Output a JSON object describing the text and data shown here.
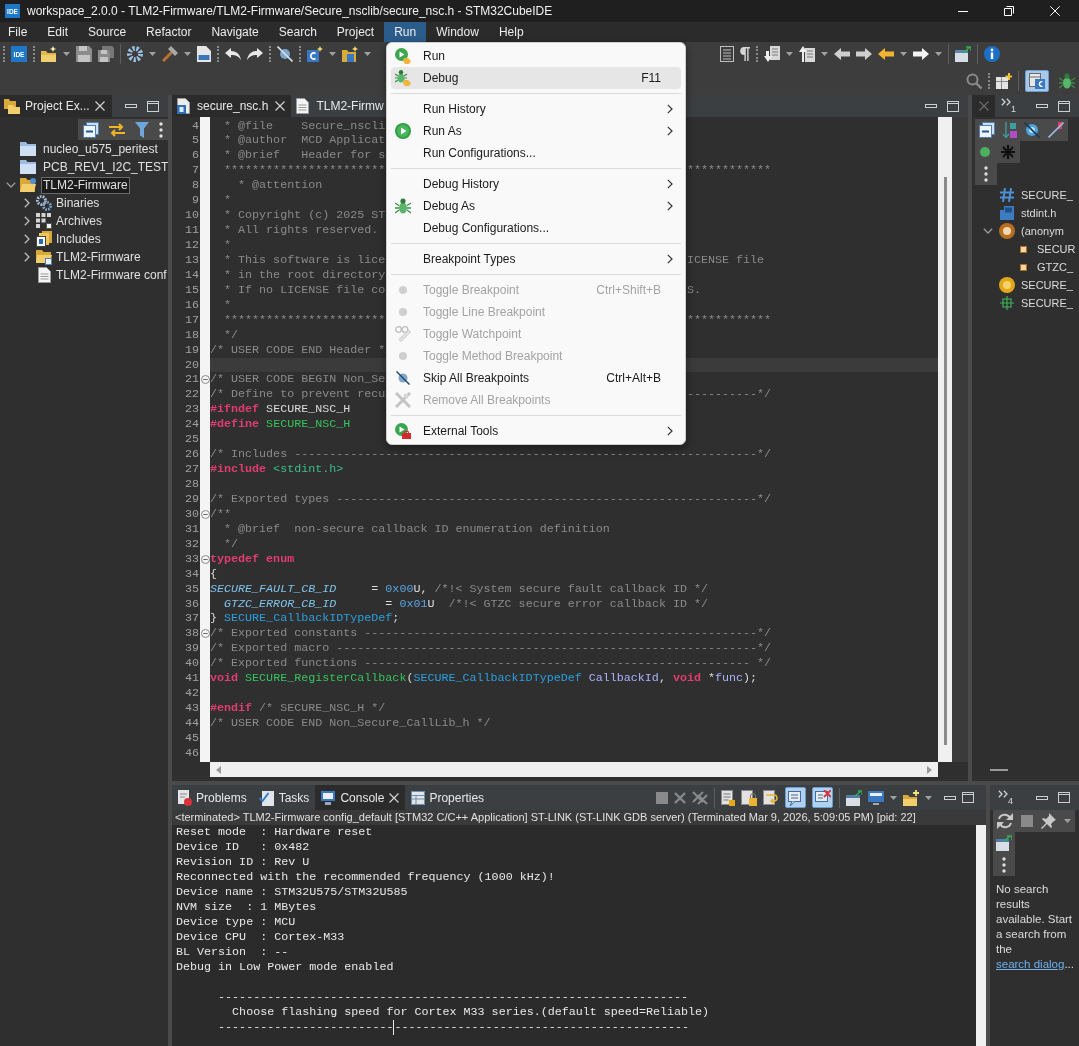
{
  "window": {
    "icon_text": "IDE",
    "title": "workspace_2.0.0 - TLM2-Firmware/TLM2-Firmware/Secure_nsclib/secure_nsc.h - STM32CubeIDE"
  },
  "menu_bar": [
    {
      "label": "File",
      "selected": false
    },
    {
      "label": "Edit",
      "selected": false
    },
    {
      "label": "Source",
      "selected": false
    },
    {
      "label": "Refactor",
      "selected": false
    },
    {
      "label": "Navigate",
      "selected": false
    },
    {
      "label": "Search",
      "selected": false
    },
    {
      "label": "Project",
      "selected": false
    },
    {
      "label": "Run",
      "selected": true
    },
    {
      "label": "Window",
      "selected": false
    },
    {
      "label": "Help",
      "selected": false
    }
  ],
  "toolbar": {
    "ide_text": "IDE",
    "perspectives": [
      {
        "selected": true
      },
      {
        "selected": false
      }
    ]
  },
  "project_explorer": {
    "tab": {
      "label": "Project Ex...",
      "selected": true
    },
    "items": [
      {
        "label": "nucleo_u575_peritest",
        "kind": "closed",
        "selected": false
      },
      {
        "label": "PCB_REV1_I2C_TEST",
        "kind": "closed",
        "selected": false
      },
      {
        "label": "TLM2-Firmware",
        "kind": "project",
        "selected": true,
        "expanded": true,
        "children": [
          {
            "label": "Binaries",
            "kind": "binaries",
            "selected": false,
            "expanded": false
          },
          {
            "label": "Archives",
            "kind": "archives",
            "selected": false,
            "expanded": false
          },
          {
            "label": "Includes",
            "kind": "includes",
            "selected": false,
            "expanded": false
          },
          {
            "label": "TLM2-Firmware",
            "kind": "folder",
            "selected": false,
            "expanded": false
          },
          {
            "label": "TLM2-Firmware conf",
            "kind": "file",
            "selected": false
          }
        ]
      }
    ]
  },
  "editor": {
    "tabs": [
      {
        "label": "secure_nsc.h",
        "selected": true
      },
      {
        "label": "TLM2-Firmw",
        "selected": false
      }
    ],
    "lines": [
      {
        "num": "4",
        "current": false,
        "foldable": false,
        "tokens": [
          {
            "kind": "comment",
            "text": "  * @file    Secure_nscli"
          }
        ]
      },
      {
        "num": "5",
        "current": false,
        "foldable": false,
        "tokens": [
          {
            "kind": "comment",
            "text": "  * @author  MCD Applicat"
          }
        ]
      },
      {
        "num": "6",
        "current": false,
        "foldable": false,
        "tokens": [
          {
            "kind": "comment",
            "text": "  * @brief   Header for s"
          }
        ]
      },
      {
        "num": "7",
        "current": false,
        "foldable": false,
        "tokens": [
          {
            "kind": "comment",
            "text": "  ***********************"
          }
        ],
        "tail": [
          {
            "kind": "comment",
            "text": "************"
          }
        ]
      },
      {
        "num": "8",
        "current": false,
        "foldable": false,
        "tokens": [
          {
            "kind": "comment",
            "text": "    * @attention"
          }
        ]
      },
      {
        "num": "9",
        "current": false,
        "foldable": false,
        "tokens": [
          {
            "kind": "comment",
            "text": "  *"
          }
        ]
      },
      {
        "num": "10",
        "current": false,
        "foldable": false,
        "tokens": [
          {
            "kind": "comment",
            "text": "  * Copyright (c) 2025 ST"
          }
        ]
      },
      {
        "num": "11",
        "current": false,
        "foldable": false,
        "tokens": [
          {
            "kind": "comment",
            "text": "  * All rights reserved."
          }
        ]
      },
      {
        "num": "12",
        "current": false,
        "foldable": false,
        "tokens": [
          {
            "kind": "comment",
            "text": "  *"
          }
        ]
      },
      {
        "num": "13",
        "current": false,
        "foldable": false,
        "tokens": [
          {
            "kind": "comment",
            "text": "  * This software is lice"
          }
        ],
        "tail": [
          {
            "kind": "comment",
            "text": "ICENSE file"
          }
        ]
      },
      {
        "num": "14",
        "current": false,
        "foldable": false,
        "tokens": [
          {
            "kind": "comment",
            "text": "  * in the root directory"
          }
        ]
      },
      {
        "num": "15",
        "current": false,
        "foldable": false,
        "tokens": [
          {
            "kind": "comment",
            "text": "  * If no LICENSE file co"
          }
        ],
        "tail": [
          {
            "kind": "comment",
            "text": "S."
          }
        ]
      },
      {
        "num": "16",
        "current": false,
        "foldable": false,
        "tokens": [
          {
            "kind": "comment",
            "text": "  *"
          }
        ]
      },
      {
        "num": "17",
        "current": false,
        "foldable": false,
        "tokens": [
          {
            "kind": "comment",
            "text": "  ***********************"
          }
        ],
        "tail": [
          {
            "kind": "comment",
            "text": "************"
          }
        ]
      },
      {
        "num": "18",
        "current": false,
        "foldable": false,
        "tokens": [
          {
            "kind": "comment",
            "text": "  */"
          }
        ]
      },
      {
        "num": "19",
        "current": false,
        "foldable": false,
        "tokens": [
          {
            "kind": "comment",
            "text": "/* USER CODE END Header *"
          }
        ]
      },
      {
        "num": "20",
        "current": true,
        "foldable": false
      },
      {
        "num": "21",
        "current": false,
        "foldable": true,
        "tokens": [
          {
            "kind": "comment",
            "text": "/* USER CODE BEGIN Non_Se"
          }
        ]
      },
      {
        "num": "22",
        "current": false,
        "foldable": false,
        "tokens": [
          {
            "kind": "comment",
            "text": "/* Define to prevent recu"
          }
        ],
        "tail": [
          {
            "kind": "comment",
            "text": "----------*/"
          }
        ]
      },
      {
        "num": "23",
        "current": false,
        "foldable": false,
        "tokens": [
          {
            "kind": "directive",
            "text": "#ifndef"
          },
          {
            "kind": "plain",
            "text": " SECURE_NSC_H"
          }
        ]
      },
      {
        "num": "24",
        "current": false,
        "foldable": false,
        "tokens": [
          {
            "kind": "directive",
            "text": "#define"
          },
          {
            "kind": "macro",
            "text": " SECURE_NSC_H"
          }
        ]
      },
      {
        "num": "25",
        "current": false,
        "foldable": false
      },
      {
        "num": "26",
        "current": false,
        "foldable": false,
        "tokens": [
          {
            "kind": "comment",
            "text": "/* Includes ------------------------------------------------------------------*/"
          }
        ]
      },
      {
        "num": "27",
        "current": false,
        "foldable": false,
        "tokens": [
          {
            "kind": "directive",
            "text": "#include"
          },
          {
            "kind": "header",
            "text": " <stdint.h>"
          }
        ]
      },
      {
        "num": "28",
        "current": false,
        "foldable": false
      },
      {
        "num": "29",
        "current": false,
        "foldable": false,
        "tokens": [
          {
            "kind": "comment",
            "text": "/* Exported types ------------------------------------------------------------*/"
          }
        ]
      },
      {
        "num": "30",
        "current": false,
        "foldable": true,
        "tokens": [
          {
            "kind": "comment",
            "text": "/**"
          }
        ]
      },
      {
        "num": "31",
        "current": false,
        "foldable": false,
        "tokens": [
          {
            "kind": "comment",
            "text": "  * @brief  non-secure callback ID enumeration definition"
          }
        ]
      },
      {
        "num": "32",
        "current": false,
        "foldable": false,
        "tokens": [
          {
            "kind": "comment",
            "text": "  */"
          }
        ]
      },
      {
        "num": "33",
        "current": false,
        "foldable": true,
        "tokens": [
          {
            "kind": "keyword",
            "text": "typedef enum"
          }
        ]
      },
      {
        "num": "34",
        "current": false,
        "foldable": false,
        "tokens": [
          {
            "kind": "plain",
            "text": "{"
          }
        ]
      },
      {
        "num": "35",
        "current": false,
        "foldable": false,
        "tokens": [
          {
            "kind": "enumerator",
            "text": "SECURE_FAULT_CB_ID"
          },
          {
            "kind": "plain",
            "text": "     = "
          },
          {
            "kind": "number",
            "text": "0x00"
          },
          {
            "kind": "plain",
            "text": "U, "
          },
          {
            "kind": "comment",
            "text": "/*!< System secure fault callback ID */"
          }
        ]
      },
      {
        "num": "36",
        "current": false,
        "foldable": false,
        "tokens": [
          {
            "kind": "enumerator",
            "text": "  GTZC_ERROR_CB_ID"
          },
          {
            "kind": "plain",
            "text": "       = "
          },
          {
            "kind": "number",
            "text": "0x01"
          },
          {
            "kind": "plain",
            "text": "U  "
          },
          {
            "kind": "comment",
            "text": "/*!< GTZC secure error callback ID */"
          }
        ]
      },
      {
        "num": "37",
        "current": false,
        "foldable": false,
        "tokens": [
          {
            "kind": "plain",
            "text": "} "
          },
          {
            "kind": "type",
            "text": "SECURE_CallbackIDTypeDef"
          },
          {
            "kind": "plain",
            "text": ";"
          }
        ]
      },
      {
        "num": "38",
        "current": false,
        "foldable": true,
        "tokens": [
          {
            "kind": "comment",
            "text": "/* Exported constants --------------------------------------------------------*/"
          }
        ]
      },
      {
        "num": "39",
        "current": false,
        "foldable": false,
        "tokens": [
          {
            "kind": "comment",
            "text": "/* Exported macro ------------------------------------------------------------*/"
          }
        ]
      },
      {
        "num": "40",
        "current": false,
        "foldable": false,
        "tokens": [
          {
            "kind": "comment",
            "text": "/* Exported functions ------------------------------------------------------- */"
          }
        ]
      },
      {
        "num": "41",
        "current": false,
        "foldable": false,
        "tokens": [
          {
            "kind": "keyword",
            "text": "void"
          },
          {
            "kind": "macro",
            "text": " SECURE_RegisterCallback"
          },
          {
            "kind": "plain",
            "text": "("
          },
          {
            "kind": "type",
            "text": "SECURE_CallbackIDTypeDef"
          },
          {
            "kind": "param",
            "text": " CallbackId"
          },
          {
            "kind": "plain",
            "text": ", "
          },
          {
            "kind": "keyword",
            "text": "void"
          },
          {
            "kind": "plain",
            "text": " *"
          },
          {
            "kind": "param",
            "text": "func"
          },
          {
            "kind": "plain",
            "text": ");"
          }
        ]
      },
      {
        "num": "42",
        "current": false,
        "foldable": false
      },
      {
        "num": "43",
        "current": false,
        "foldable": false,
        "tokens": [
          {
            "kind": "directive",
            "text": "#endif"
          },
          {
            "kind": "comment",
            "text": " /* SECURE_NSC_H */"
          }
        ]
      },
      {
        "num": "44",
        "current": false,
        "foldable": false,
        "tokens": [
          {
            "kind": "comment",
            "text": "/* USER CODE END Non_Secure_CallLib_h */"
          }
        ]
      },
      {
        "num": "45",
        "current": false,
        "foldable": false
      },
      {
        "num": "46",
        "current": false,
        "foldable": false
      }
    ]
  },
  "run_menu": {
    "groups": [
      [
        {
          "label": "Run",
          "submenu": false,
          "disabled": false,
          "highlighted": false
        },
        {
          "label": "Debug",
          "shortcut": "F11",
          "submenu": false,
          "disabled": false,
          "highlighted": true
        }
      ],
      [
        {
          "label": "Run History",
          "submenu": true,
          "disabled": false,
          "highlighted": false
        },
        {
          "label": "Run As",
          "submenu": true,
          "disabled": false,
          "highlighted": false
        },
        {
          "label": "Run Configurations...",
          "submenu": false,
          "disabled": false,
          "highlighted": false
        }
      ],
      [
        {
          "label": "Debug History",
          "submenu": true,
          "disabled": false,
          "highlighted": false
        },
        {
          "label": "Debug As",
          "submenu": true,
          "disabled": false,
          "highlighted": false
        },
        {
          "label": "Debug Configurations...",
          "submenu": false,
          "disabled": false,
          "highlighted": false
        }
      ],
      [
        {
          "label": "Breakpoint Types",
          "submenu": true,
          "disabled": false,
          "highlighted": false
        }
      ],
      [
        {
          "label": "Toggle Breakpoint",
          "shortcut": "Ctrl+Shift+B",
          "submenu": false,
          "disabled": true,
          "highlighted": false
        },
        {
          "label": "Toggle Line Breakpoint",
          "submenu": false,
          "disabled": true,
          "highlighted": false
        },
        {
          "label": "Toggle Watchpoint",
          "submenu": false,
          "disabled": true,
          "highlighted": false
        },
        {
          "label": "Toggle Method Breakpoint",
          "submenu": false,
          "disabled": true,
          "highlighted": false
        },
        {
          "label": "Skip All Breakpoints",
          "shortcut": "Ctrl+Alt+B",
          "submenu": false,
          "disabled": false,
          "highlighted": false
        },
        {
          "label": "Remove All Breakpoints",
          "submenu": false,
          "disabled": true,
          "highlighted": false
        }
      ],
      [
        {
          "label": "External Tools",
          "submenu": true,
          "disabled": false,
          "highlighted": false
        }
      ]
    ]
  },
  "outline": {
    "overflow_count": "1",
    "items": [
      {
        "label": "SECURE_",
        "kind": "macro"
      },
      {
        "label": "stdint.h",
        "kind": "include"
      },
      {
        "label": "(anonym",
        "kind": "enum",
        "expanded": true,
        "children": [
          {
            "label": "SECUR",
            "kind": "enumerator"
          },
          {
            "label": "GTZC_",
            "kind": "enumerator"
          }
        ]
      },
      {
        "label": "SECURE_",
        "kind": "typedef"
      },
      {
        "label": "SECURE_",
        "kind": "function"
      }
    ]
  },
  "console": {
    "tabs": [
      {
        "label": "Problems",
        "selected": false
      },
      {
        "label": "Tasks",
        "selected": false
      },
      {
        "label": "Console",
        "selected": true
      },
      {
        "label": "Properties",
        "selected": false
      }
    ],
    "toggles": [
      {
        "selected": true
      },
      {
        "selected": true
      }
    ],
    "header": "<terminated> TLM2-Firmware config_default [STM32 C/C++ Application] ST-LINK (ST-LINK GDB server) (Terminated Mar 9, 2026, 5:09:05 PM) [pid: 22]",
    "lines": [
      "Reset mode  : Hardware reset",
      "Device ID   : 0x482",
      "Revision ID : Rev U",
      "Reconnected with the recommended frequency (1000 kHz)!",
      "Device name : STM32U575/STM32U585",
      "NVM size  : 1 MBytes",
      "Device type : MCU",
      "Device CPU  : Cortex-M33",
      "BL Version  : --",
      "Debug in Low Power mode enabled"
    ],
    "banner": [
      "      -------------------------------------------------------------------",
      "        Choose flashing speed for Cortex M33 series.(default speed=Reliable)"
    ],
    "caret_line": {
      "before": "      -------------------------",
      "after": "------------------------------------------"
    }
  },
  "search_view": {
    "overflow_count": "4",
    "message": "No search results available. Start a search from the",
    "link": "search dialog",
    "message_end": "..."
  }
}
